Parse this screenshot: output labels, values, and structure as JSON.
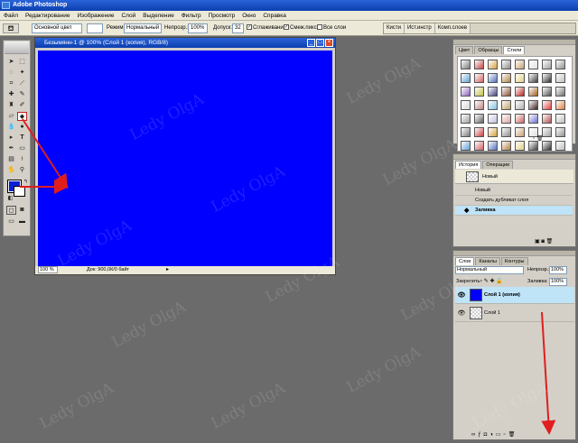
{
  "app": {
    "title": "Adobe Photoshop"
  },
  "menu": [
    "Файл",
    "Редактирование",
    "Изображение",
    "Слой",
    "Выделение",
    "Фильтр",
    "Просмотр",
    "Окно",
    "Справка"
  ],
  "options": {
    "fill_source": "Основной цвет",
    "mode_label": "Режим:",
    "mode_value": "Нормальный",
    "opacity_label": "Непрозр.:",
    "opacity_value": "100%",
    "tolerance_label": "Допуск:",
    "tolerance_value": "32",
    "antialias_label": "Сглаживание",
    "contiguous_label": "Смеж.пикс",
    "all_layers_label": "Все слои"
  },
  "well_tabs": [
    "Кисти",
    "Ист.инстр",
    "Комп.слоев"
  ],
  "document": {
    "title": "Безымянн-1 @ 100% (Слой 1 (копия), RGB/8)",
    "zoom": "100 %",
    "doc_size": "Док: 900,0К/0 байт",
    "canvas_color": "#0000ff"
  },
  "tools": {
    "fg_color": "#0a1fd8",
    "bg_color": "#ffffff"
  },
  "styles_panel": {
    "tabs": [
      "Цвет",
      "Образцы",
      "Стили"
    ],
    "active_tab": "Стили"
  },
  "history_panel": {
    "tabs": [
      "История",
      "Операции"
    ],
    "snapshot": "Новый",
    "items": [
      "Новый",
      "Создать дубликат слоя",
      "Заливка"
    ],
    "active_item": "Заливка"
  },
  "layers_panel": {
    "tabs": [
      "Слои",
      "Каналы",
      "Контуры"
    ],
    "blend_mode": "Нормальный",
    "opacity_label": "Непрозр.:",
    "opacity_value": "100%",
    "lock_label": "Закрепить:",
    "fill_label": "Заливка:",
    "fill_value": "100%",
    "layers": [
      {
        "name": "Слой 1 (копия)",
        "selected": true,
        "thumb_color": "#0000ff"
      },
      {
        "name": "Слой 1",
        "selected": false,
        "thumb_color": "transparent"
      }
    ]
  },
  "watermark": "Ledy OlgA",
  "accent_colors": {
    "arrow": "#e01e1e",
    "titlebar": "#0b3fb0",
    "selection": "#bfe3f7"
  }
}
